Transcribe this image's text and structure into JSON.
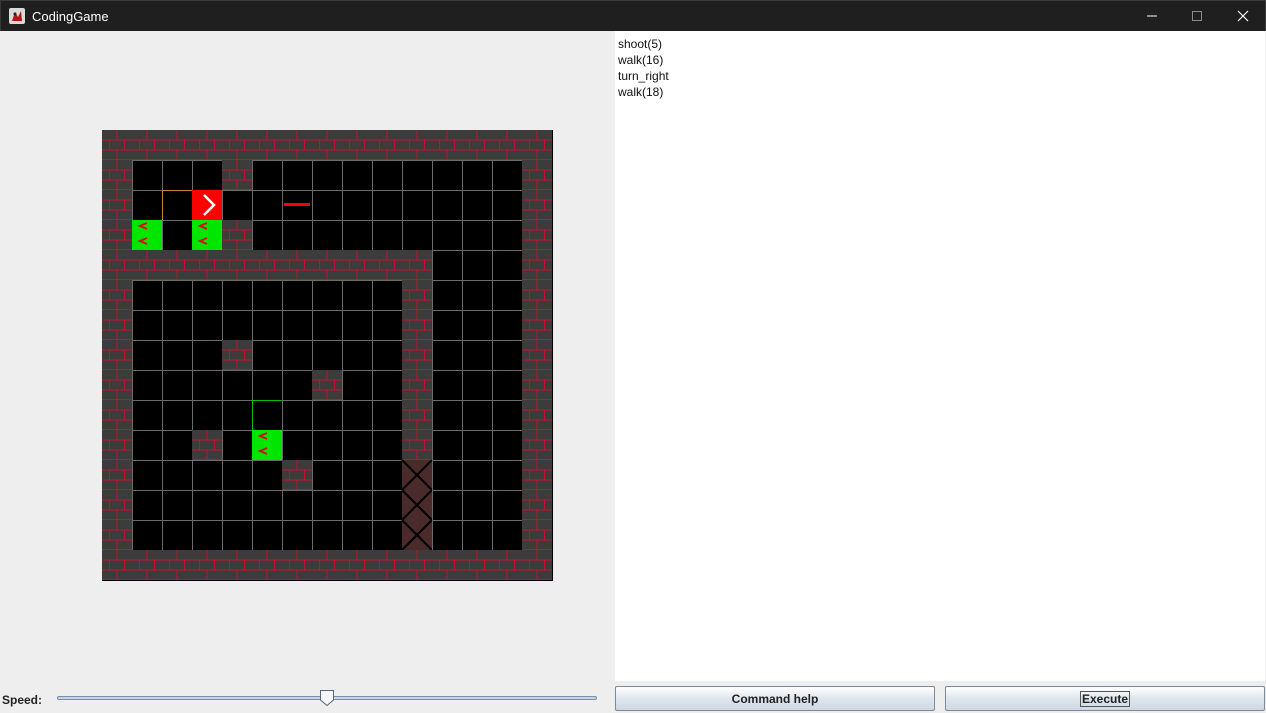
{
  "window": {
    "title": "CodingGame",
    "app_icon": "app-logo-icon",
    "controls": [
      "minimize-icon",
      "maximize-icon",
      "close-icon"
    ]
  },
  "board": {
    "cols": 15,
    "rows": 15,
    "legend": {
      "W": "brick-wall",
      "B": "floor-black",
      "O": "floor-outlined-tile",
      "P": "player-red-tile",
      "E": "enemy-green-tile",
      "G": "green-outlined-tile",
      "X": "crosshatched-gate-tile",
      "L": "laser-beam-tile"
    },
    "grid": [
      "WWWWWWWWWWWWWWW",
      "WBBBWBBBBBBBBBW",
      "WBOPBBLBBBBBBBW",
      "WEBEWBBBBBBBBBW",
      "WWWWWWWWWWWBBBW",
      "WBBBBBBBBBWBBBW",
      "WBBBBBBBBBWBBBW",
      "WBBBWBBBBBWBBBW",
      "WBBBBBBWBBWBBBW",
      "WBBBBGBBBBWBBBW",
      "WBBWBEBBBBWBBBW",
      "WBBBBBWBBBXBBBW",
      "WBBBBBBBBBXBBBW",
      "WBBBBBBBBBXBBBW",
      "WWWWWWWWWWWWWWW"
    ],
    "colors": {
      "wall": "#3c3c3c",
      "mortar": "#c8102e",
      "floor": "#000000",
      "gridline": "#6b6b6b",
      "player": "#ff0000",
      "enemy": "#00e600",
      "laser": "#ff0000",
      "outline_tile": "#c8842e",
      "green_outline": "#00c000"
    }
  },
  "code": {
    "lines": [
      "shoot(5)",
      "walk(16)",
      "turn_right",
      "walk(18)"
    ]
  },
  "speed": {
    "label": "Speed:",
    "value_fraction": 0.5
  },
  "buttons": {
    "help_label": "Command help",
    "execute_label": "Execute"
  }
}
